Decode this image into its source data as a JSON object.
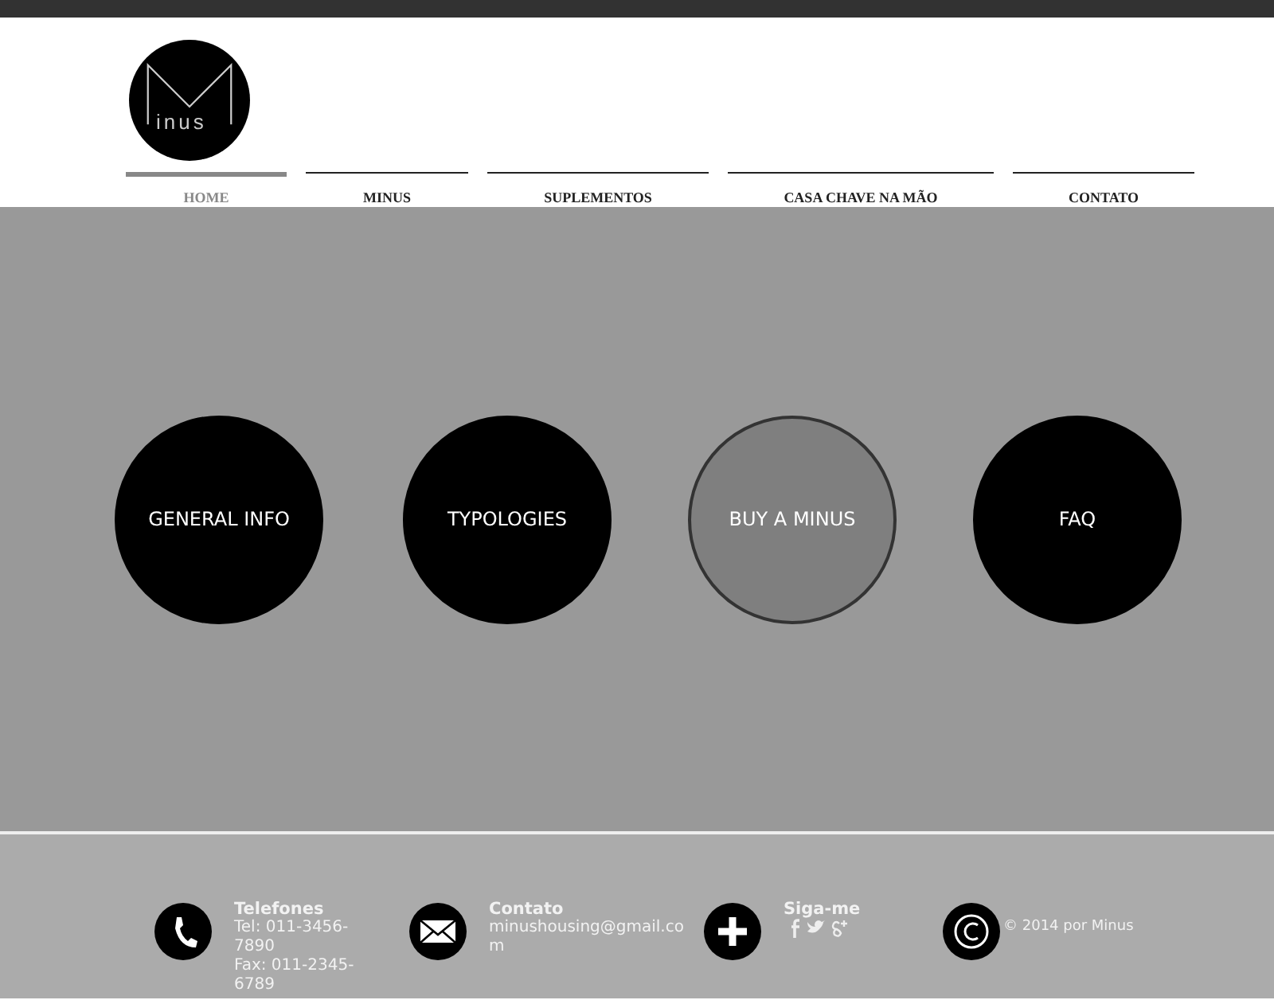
{
  "logo": {
    "text": "inus"
  },
  "nav": [
    {
      "label": "HOME",
      "selected": true
    },
    {
      "label": "MINUS",
      "selected": false
    },
    {
      "label": "SUPLEMENTOS",
      "selected": false
    },
    {
      "label": "CASA CHAVE NA MÃO",
      "selected": false
    },
    {
      "label": "CONTATO",
      "selected": false
    }
  ],
  "circles": [
    {
      "label": "GENERAL INFO",
      "selected": false
    },
    {
      "label": "TYPOLOGIES",
      "selected": false
    },
    {
      "label": "BUY A MINUS",
      "selected": true
    },
    {
      "label": "FAQ",
      "selected": false
    }
  ],
  "footer": [
    {
      "kind": "phone",
      "title": "Telefones",
      "lines": [
        "Tel: 011-3456-",
        "7890",
        "Fax: 011-2345-",
        "6789"
      ]
    },
    {
      "kind": "mail",
      "title": "Contato",
      "lines": [
        "minushousing@gmail.co",
        "m"
      ]
    },
    {
      "kind": "social",
      "title": "Siga-me"
    },
    {
      "kind": "copyright",
      "lines": [
        "© 2014 por Minus"
      ]
    }
  ]
}
